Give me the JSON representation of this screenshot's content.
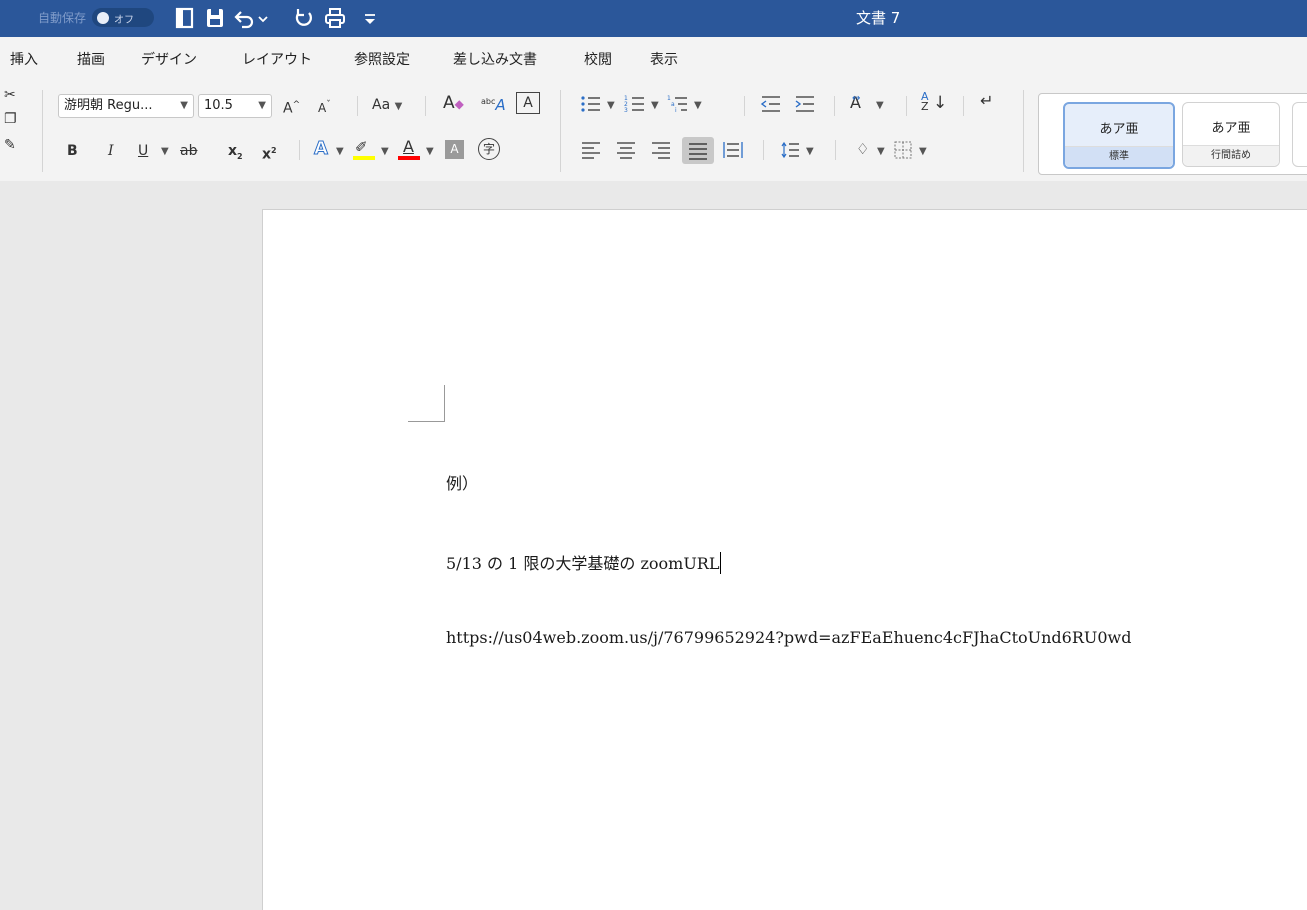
{
  "titlebar": {
    "autosave_label": "自動保存",
    "autosave_state": "オフ",
    "doc_title": "文書 7"
  },
  "menu": [
    "挿入",
    "描画",
    "デザイン",
    "レイアウト",
    "参照設定",
    "差し込み文書",
    "校閲",
    "表示"
  ],
  "ribbon": {
    "font_name": "游明朝 Regu...",
    "font_size": "10.5",
    "grow_font": "A",
    "shrink_font": "A",
    "change_case": "Aa",
    "bold": "B",
    "italic": "I",
    "underline": "U",
    "strikethrough": "ab",
    "subscript": "x",
    "superscript": "x",
    "text_effects": "A",
    "font_color": "A",
    "char_shading": "A",
    "enclose_char": "字",
    "phonetic": "abc",
    "char_border": "A",
    "styles": [
      {
        "preview": "あア亜",
        "name": "標準",
        "selected": true
      },
      {
        "preview": "あア亜",
        "name": "行間詰め",
        "selected": false
      }
    ]
  },
  "document": {
    "line1": "例）",
    "line2": "5/13 の 1 限の大学基礎の zoomURL",
    "line3": "https://us04web.zoom.us/j/76799652924?pwd=azFEaEhuenc4cFJhaCtoUnd6RU0wd"
  },
  "colors": {
    "titlebar": "#2b579a",
    "highlight": "#ffff00",
    "font_color": "#ff0000"
  }
}
